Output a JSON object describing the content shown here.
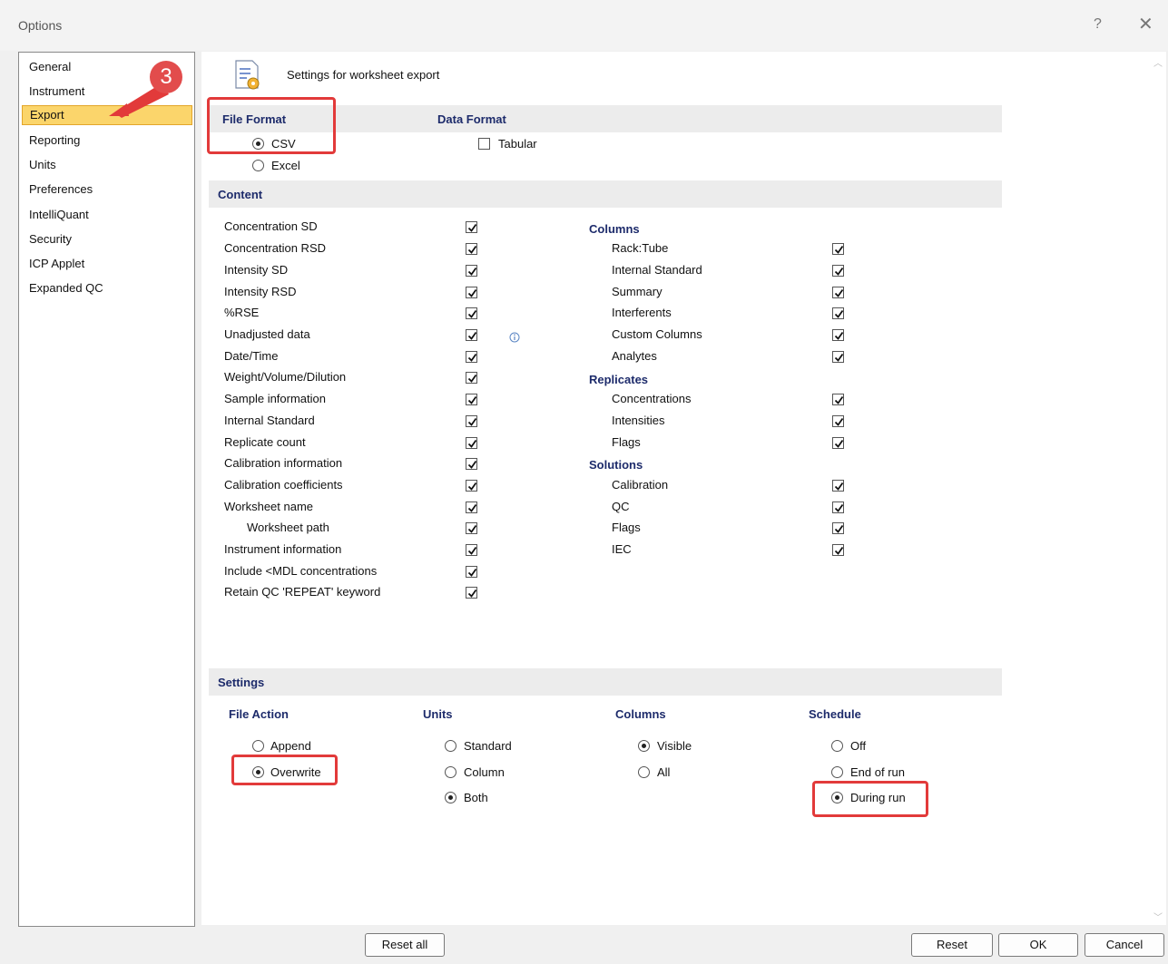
{
  "window": {
    "title": "Options",
    "help": "?",
    "close": "✕"
  },
  "sidebar": {
    "items": [
      {
        "label": "General"
      },
      {
        "label": "Instrument"
      },
      {
        "label": "Export"
      },
      {
        "label": "Reporting"
      },
      {
        "label": "Units"
      },
      {
        "label": "Preferences"
      },
      {
        "label": "IntelliQuant"
      },
      {
        "label": "Security"
      },
      {
        "label": "ICP Applet"
      },
      {
        "label": "Expanded QC"
      }
    ],
    "selected": "Export"
  },
  "annotation": {
    "badge": "3",
    "accent": "#e23a3a"
  },
  "header": {
    "title": "Settings for worksheet export"
  },
  "file_format": {
    "heading": "File Format",
    "options": [
      {
        "label": "CSV",
        "checked": true
      },
      {
        "label": "Excel",
        "checked": false
      }
    ]
  },
  "data_format": {
    "heading": "Data Format",
    "tabular_label": "Tabular",
    "tabular_checked": false
  },
  "content": {
    "heading": "Content",
    "left": [
      {
        "label": "Concentration SD",
        "checked": true
      },
      {
        "label": "Concentration RSD",
        "checked": true
      },
      {
        "label": "Intensity SD",
        "checked": true
      },
      {
        "label": "Intensity RSD",
        "checked": true
      },
      {
        "label": "%RSE",
        "checked": true
      },
      {
        "label": "Unadjusted data",
        "checked": true
      },
      {
        "label": "Date/Time",
        "checked": true
      },
      {
        "label": "Weight/Volume/Dilution",
        "checked": true
      },
      {
        "label": "Sample information",
        "checked": true
      },
      {
        "label": "Internal Standard",
        "checked": true
      },
      {
        "label": "Replicate count",
        "checked": true
      },
      {
        "label": "Calibration information",
        "checked": true
      },
      {
        "label": "Calibration coefficients",
        "checked": true
      },
      {
        "label": "Worksheet name",
        "checked": true
      },
      {
        "label": "Worksheet path",
        "checked": true
      },
      {
        "label": "Instrument information",
        "checked": true
      },
      {
        "label": "Include <MDL concentrations",
        "checked": true
      },
      {
        "label": "Retain QC 'REPEAT' keyword",
        "checked": true
      }
    ],
    "columns_heading": "Columns",
    "columns": [
      {
        "label": "Rack:Tube",
        "checked": true
      },
      {
        "label": "Internal Standard",
        "checked": true
      },
      {
        "label": "Summary",
        "checked": true
      },
      {
        "label": "Interferents",
        "checked": true
      },
      {
        "label": "Custom Columns",
        "checked": true
      },
      {
        "label": "Analytes",
        "checked": true
      }
    ],
    "replicates_heading": "Replicates",
    "replicates": [
      {
        "label": "Concentrations",
        "checked": true
      },
      {
        "label": "Intensities",
        "checked": true
      },
      {
        "label": "Flags",
        "checked": true
      }
    ],
    "solutions_heading": "Solutions",
    "solutions": [
      {
        "label": "Calibration",
        "checked": true
      },
      {
        "label": "QC",
        "checked": true
      },
      {
        "label": "Flags",
        "checked": true
      },
      {
        "label": "IEC",
        "checked": true
      }
    ]
  },
  "settings": {
    "heading": "Settings",
    "file_action": {
      "heading": "File Action",
      "options": [
        {
          "label": "Append",
          "checked": false
        },
        {
          "label": "Overwrite",
          "checked": true
        }
      ]
    },
    "units": {
      "heading": "Units",
      "options": [
        {
          "label": "Standard",
          "checked": false
        },
        {
          "label": "Column",
          "checked": false
        },
        {
          "label": "Both",
          "checked": true
        }
      ]
    },
    "columns": {
      "heading": "Columns",
      "options": [
        {
          "label": "Visible",
          "checked": true
        },
        {
          "label": "All",
          "checked": false
        }
      ]
    },
    "schedule": {
      "heading": "Schedule",
      "options": [
        {
          "label": "Off",
          "checked": false
        },
        {
          "label": "End of run",
          "checked": false
        },
        {
          "label": "During run",
          "checked": true
        }
      ]
    }
  },
  "buttons": {
    "reset_all": "Reset all",
    "reset": "Reset",
    "ok": "OK",
    "cancel": "Cancel"
  }
}
